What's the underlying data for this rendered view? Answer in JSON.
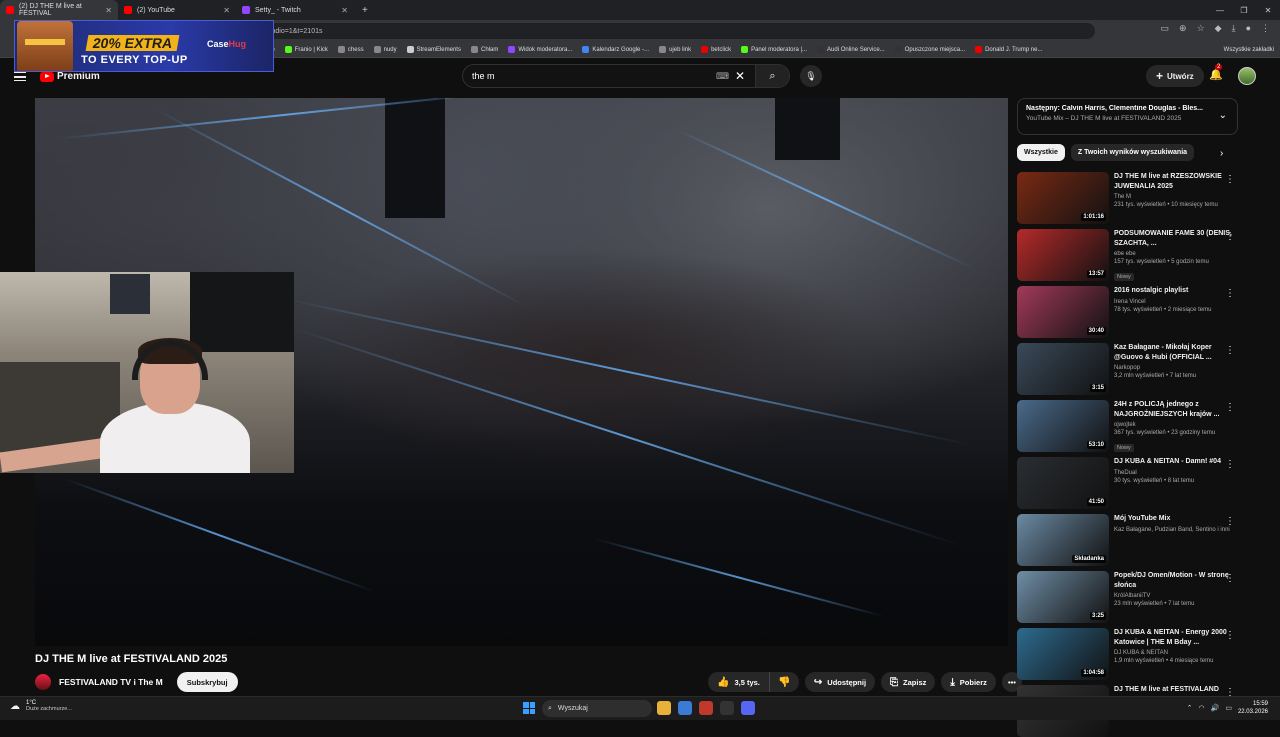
{
  "browser": {
    "tabs": [
      {
        "label": "(2) DJ THE M live at FESTIVAL",
        "color": "#ff0000",
        "active": true
      },
      {
        "label": "(2) YouTube",
        "color": "#ff0000",
        "active": false
      },
      {
        "label": "Setty_ - Twitch",
        "color": "#9146ff",
        "active": false
      }
    ],
    "new_tab": "+",
    "url": "rt_radio=1&t=2101s",
    "bookmarks": [
      {
        "label": "op",
        "color": "#888"
      },
      {
        "label": "Franio | Kick",
        "color": "#53fc18"
      },
      {
        "label": "chess",
        "color": "#888"
      },
      {
        "label": "nudy",
        "color": "#888"
      },
      {
        "label": "StreamElements",
        "color": "#ccc"
      },
      {
        "label": "Chłam",
        "color": "#888"
      },
      {
        "label": "Widok moderatora...",
        "color": "#9146ff"
      },
      {
        "label": "Kalendarz Google -...",
        "color": "#4285f4"
      },
      {
        "label": "ujeb link",
        "color": "#888"
      },
      {
        "label": "betclick",
        "color": "#e00"
      },
      {
        "label": "Panel moderatora |...",
        "color": "#53fc18"
      },
      {
        "label": "Audi Online Service...",
        "color": "#333"
      },
      {
        "label": "Opuszczone miejsca...",
        "color": "#333"
      },
      {
        "label": "Donald J. Trump ne...",
        "color": "#e00"
      }
    ],
    "bookmarks_right": "Wszystkie zakładki"
  },
  "ad": {
    "line1": "20% EXTRA",
    "line2": "TO EVERY TOP-UP",
    "brand_a": "Case",
    "brand_b": "Hug"
  },
  "youtube": {
    "logo_text": "Premium",
    "search_value": "the m",
    "create_label": "Utwórz",
    "notif_count": "2"
  },
  "video": {
    "title": "DJ THE M live at FESTIVALAND 2025",
    "channel": "FESTIVALAND TV i The M",
    "subscribe": "Subskrybuj",
    "likes": "3,5 tys.",
    "share": "Udostępnij",
    "save": "Zapisz",
    "download": "Pobierz"
  },
  "sidebar": {
    "next_line1": "Następny: Calvin Harris, Clementine Douglas - Bles...",
    "next_line2": "YouTube Mix – DJ THE M live at FESTIVALAND 2025",
    "chips": [
      "Wszystkie",
      "Z Twoich wyników wyszukiwania"
    ],
    "items": [
      {
        "title": "DJ THE M live at RZESZOWSKIE JUWENALIA 2025",
        "channel": "The M",
        "meta": "231 tys. wyświetleń • 10 miesięcy temu",
        "duration": "1:01:16",
        "badge": "",
        "thumb": "#7a2a14"
      },
      {
        "title": "PODSUMOWANIE FAME 30 (DENIS, SZACHTA, ...",
        "channel": "ebe ebe",
        "meta": "157 tys. wyświetleń • 5 godzin temu",
        "duration": "13:57",
        "badge": "Nowy",
        "thumb": "#b52a2a"
      },
      {
        "title": "2016 nostalgic playlist",
        "channel": "Irena Vincel",
        "meta": "78 tys. wyświetleń • 2 miesiące temu",
        "duration": "30:40",
        "badge": "",
        "thumb": "#a23a5a"
      },
      {
        "title": "Kaz Bałagane - Mikołaj Koper @Guovo & Hubi (OFFICIAL ...",
        "channel": "Narkopop",
        "meta": "3,2 mln wyświetleń • 7 lat temu",
        "duration": "3:15",
        "badge": "",
        "thumb": "#3a4a5a"
      },
      {
        "title": "24H z POLICJĄ jednego z NAJGROŹNIEJSZYCH krajów ...",
        "channel": "ojwojtek",
        "meta": "367 tys. wyświetleń • 23 godziny temu",
        "duration": "53:10",
        "badge": "Nowy",
        "thumb": "#4a6a8a"
      },
      {
        "title": "DJ KUBA & NEITAN - Damn! #04",
        "channel": "TheDual",
        "meta": "30 tys. wyświetleń • 8 lat temu",
        "duration": "41:50",
        "badge": "",
        "thumb": "#2a2e33"
      },
      {
        "title": "Mój YouTube Mix",
        "channel": "Kaz Bałagane, Pudzian Band, Sentino i inni",
        "meta": "",
        "duration": "Składanka",
        "badge": "",
        "thumb": "#6b8aa3"
      },
      {
        "title": "Popek/DJ Omen/Motion - W stronę słońca",
        "channel": "KrólAlbaniiTV",
        "meta": "23 mln wyświetleń • 7 lat temu",
        "duration": "3:25",
        "badge": "",
        "thumb": "#6f8ea6"
      },
      {
        "title": "DJ KUBA & NEITAN - Energy 2000 Katowice | THE M Bday ...",
        "channel": "DJ KUBA & NEITAN",
        "meta": "1,9 mln wyświetleń • 4 miesiące temu",
        "duration": "1:04:58",
        "badge": "",
        "thumb": "#2d6b8f"
      },
      {
        "title": "DJ THE M live at FESTIVALAND",
        "channel": "",
        "meta": "",
        "duration": "",
        "badge": "",
        "thumb": "#333"
      }
    ]
  },
  "taskbar": {
    "temp": "1°C",
    "weather": "Duże zachmurze...",
    "search": "Wyszukaj",
    "time": "15:59",
    "date": "22.03.2026",
    "apps": [
      "#e8b23a",
      "#3a7bd5",
      "#c0392b",
      "#333",
      "#5865f2"
    ]
  }
}
